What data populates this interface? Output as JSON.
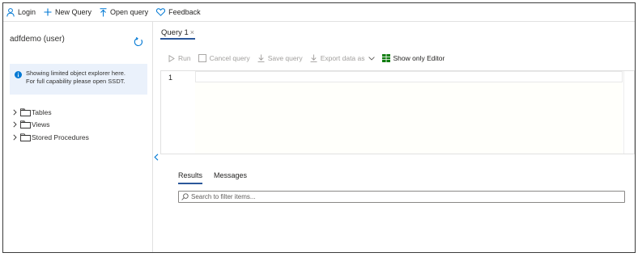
{
  "toolbar": {
    "login_label": "Login",
    "new_query_label": "New Query",
    "open_query_label": "Open query",
    "feedback_label": "Feedback"
  },
  "explorer": {
    "connection_title": "adfdemo (user)",
    "info_line1": "Showing limited object explorer here.",
    "info_line2": "For full capability please open SSDT.",
    "items": [
      {
        "label": "Tables"
      },
      {
        "label": "Views"
      },
      {
        "label": "Stored Procedures"
      }
    ]
  },
  "editor": {
    "tab_label": "Query 1",
    "tab_close": "×",
    "run_label": "Run",
    "cancel_label": "Cancel query",
    "save_label": "Save query",
    "export_label": "Export data as",
    "show_editor_label": "Show only Editor",
    "line_number": "1"
  },
  "results": {
    "tab_results": "Results",
    "tab_messages": "Messages",
    "filter_placeholder": "Search to filter items..."
  },
  "colors": {
    "accent": "#2b579a",
    "icon_blue": "#0078d4",
    "info_bg": "#eaf1fb",
    "grid_green": "#107c10"
  },
  "icons": [
    "person-icon",
    "plus-icon",
    "upload-icon",
    "heart-icon",
    "refresh-icon",
    "info-icon",
    "chevron-right-icon",
    "folder-icon",
    "play-icon",
    "checkbox-icon",
    "download-icon",
    "chevron-down-icon",
    "grid-icon",
    "chevron-left-icon",
    "search-icon"
  ]
}
